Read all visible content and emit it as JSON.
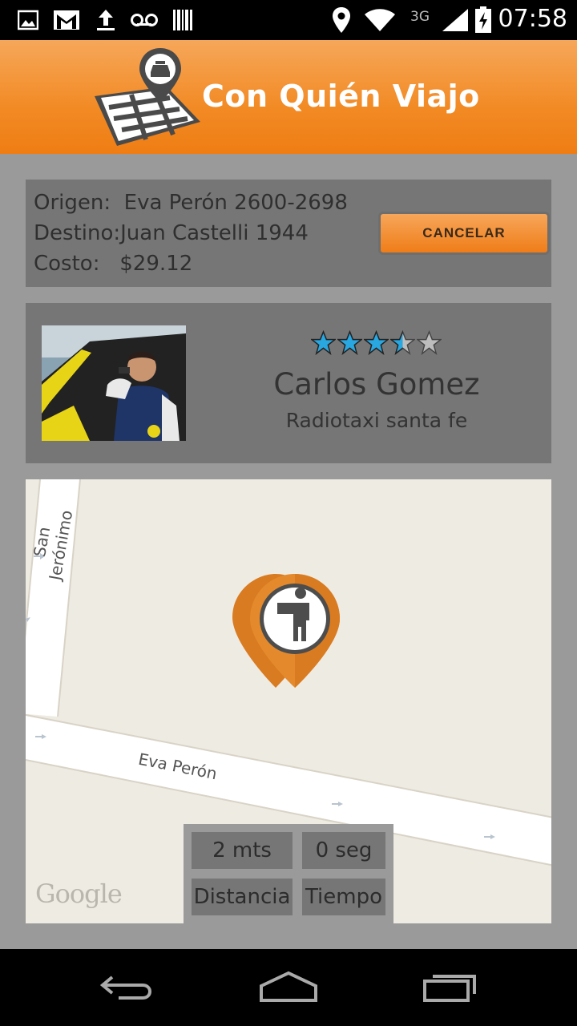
{
  "status_bar": {
    "icons": [
      "image-icon",
      "gmail-icon",
      "upload-icon",
      "voicemail-icon",
      "barcode-icon",
      "location-icon",
      "wifi-icon",
      "network-3g-icon",
      "signal-icon",
      "battery-charging-icon"
    ],
    "network_label": "3G",
    "time": "07:58"
  },
  "app_bar": {
    "title": "Con Quién Viajo",
    "logo_icon": "taxi-map-logo-icon"
  },
  "trip": {
    "origin": "Origen:  Eva Perón 2600-2698",
    "destination": "Destino:Juan Castelli 1944",
    "cost": "Costo:   $29.12",
    "cancel_label": "CANCELAR"
  },
  "driver": {
    "rating": 3.5,
    "rating_max": 5,
    "name": "Carlos Gomez",
    "company": "Radiotaxi santa fe"
  },
  "map": {
    "street_1": "San Jerónimo",
    "street_2": "Eva Perón",
    "provider": "Google",
    "pin_icon": "passenger-pin-icon"
  },
  "info": {
    "distance_value": "2 mts",
    "time_value": "0 seg",
    "distance_label": "Distancia",
    "time_label": "Tiempo"
  },
  "colors": {
    "accent": "#f28a24",
    "star": "#29a7e0",
    "card": "#777677",
    "background": "#9a9a9a"
  }
}
